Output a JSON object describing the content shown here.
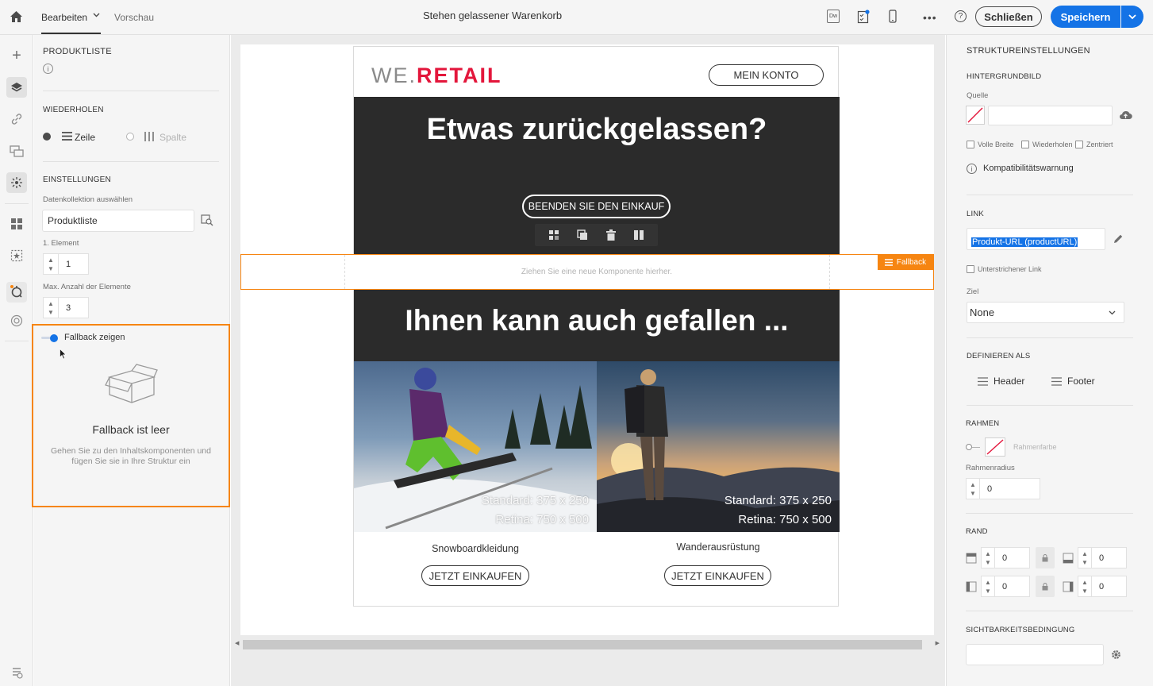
{
  "topbar": {
    "tab_edit": "Bearbeiten",
    "tab_preview": "Vorschau",
    "doc_title": "Stehen gelassener Warenkorb",
    "close_label": "Schließen",
    "save_label": "Speichern",
    "accent": "#1473e6"
  },
  "left_panel": {
    "section_title": "PRODUKTLISTE",
    "repeat_title": "WIEDERHOLEN",
    "repeat_row": "Zeile",
    "repeat_col": "Spalte",
    "settings_title": "EINSTELLUNGEN",
    "collection_label": "Datenkollektion auswählen",
    "collection_value": "Produktliste",
    "first_element_label": "1. Element",
    "first_element_value": "1",
    "max_elements_label": "Max. Anzahl der Elemente",
    "max_elements_value": "3",
    "fallback_toggle_label": "Fallback zeigen",
    "fallback_empty_title": "Fallback ist leer",
    "fallback_empty_desc": "Gehen Sie zu den Inhaltskomponenten und fügen Sie sie in Ihre Struktur ein",
    "highlight_color": "#f68511"
  },
  "email": {
    "logo_we": "WE.",
    "logo_retail": "RETAIL",
    "logo_accent": "#e3163b",
    "account_button": "MEIN KONTO",
    "hero_heading": "Etwas zurückgelassen?",
    "hero_button": "BEENDEN SIE DEN EINKAUF",
    "fallback_badge": "Fallback",
    "dropzone_text": "Ziehen Sie eine neue Komponente hierher.",
    "section_heading": "Ihnen kann auch gefallen ...",
    "products": [
      {
        "name": "Snowboardkleidung",
        "cta": "JETZT EINKAUFEN",
        "overlay_line1": "Standard: 375 x 250",
        "overlay_line2": "Retina: 750 x 500"
      },
      {
        "name": "Wanderausrüstung",
        "cta": "JETZT EINKAUFEN",
        "overlay_line1": "Standard: 375 x 250",
        "overlay_line2": "Retina: 750 x 500"
      }
    ]
  },
  "right_panel": {
    "title": "STRUKTUREINSTELLUNGEN",
    "bg_image_title": "HINTERGRUNDBILD",
    "source_label": "Quelle",
    "full_width": "Volle Breite",
    "repeat": "Wiederholen",
    "centered": "Zentriert",
    "compat_warning": "Kompatibilitätswarnung",
    "link_title": "LINK",
    "link_value": "Produkt-URL (productURL)",
    "underline_link": "Unterstrichener Link",
    "target_label": "Ziel",
    "target_value": "None",
    "define_as_title": "DEFINIEREN ALS",
    "header_label": "Header",
    "footer_label": "Footer",
    "border_title": "RAHMEN",
    "border_color_label": "Rahmenfarbe",
    "border_radius_label": "Rahmenradius",
    "border_radius_value": "0",
    "margin_title": "RAND",
    "margin_top": "0",
    "margin_bottom": "0",
    "margin_left": "0",
    "margin_right": "0",
    "visibility_title": "SICHTBARKEITSBEDINGUNG"
  }
}
